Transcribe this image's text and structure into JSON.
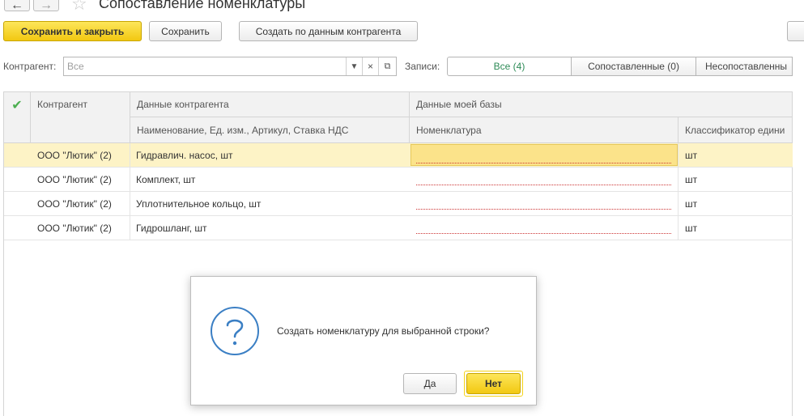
{
  "window": {
    "title": "Сопоставление номенклатуры",
    "back_icon": "arrow-left-icon",
    "forward_icon": "arrow-right-icon",
    "favorite_icon": "star-icon"
  },
  "toolbar": {
    "save_close_label": "Сохранить и закрыть",
    "save_label": "Сохранить",
    "create_by_partner_label": "Создать по данным контрагента"
  },
  "filter": {
    "counterparty_label": "Контрагент:",
    "counterparty_placeholder": "Все",
    "records_label": "Записи:",
    "segments": [
      {
        "label": "Все (4)",
        "active": true
      },
      {
        "label": "Сопоставленные (0)",
        "active": false
      },
      {
        "label": "Несопоставленны",
        "active": false
      }
    ]
  },
  "table": {
    "header": {
      "counterparty": "Контрагент",
      "partner_data": "Данные контрагента",
      "partner_data_sub": "Наименование, Ед. изм., Артикул, Ставка НДС",
      "my_data": "Данные моей базы",
      "nomenclature": "Номенклатура",
      "classifier": "Классификатор едини"
    },
    "rows": [
      {
        "counterparty": "ООО \"Лютик\" (2)",
        "item": "Гидравлич. насос, шт",
        "nomenclature": "",
        "unit": "шт",
        "selected": true
      },
      {
        "counterparty": "ООО \"Лютик\" (2)",
        "item": "Комплект, шт",
        "nomenclature": "",
        "unit": "шт",
        "selected": false
      },
      {
        "counterparty": "ООО \"Лютик\" (2)",
        "item": "Уплотнительное кольцо, шт",
        "nomenclature": "",
        "unit": "шт",
        "selected": false
      },
      {
        "counterparty": "ООО \"Лютик\" (2)",
        "item": "Гидрошланг, шт",
        "nomenclature": "",
        "unit": "шт",
        "selected": false
      }
    ]
  },
  "dialog": {
    "icon": "question-icon",
    "message": "Создать номенклатуру для выбранной строки?",
    "yes_label": "Да",
    "no_label": "Нет"
  },
  "colors": {
    "accent_yellow": "#f5d316",
    "selected_row": "#fdf3c6",
    "active_segment_text": "#2e8b57",
    "question_icon": "#3b7fc4"
  }
}
